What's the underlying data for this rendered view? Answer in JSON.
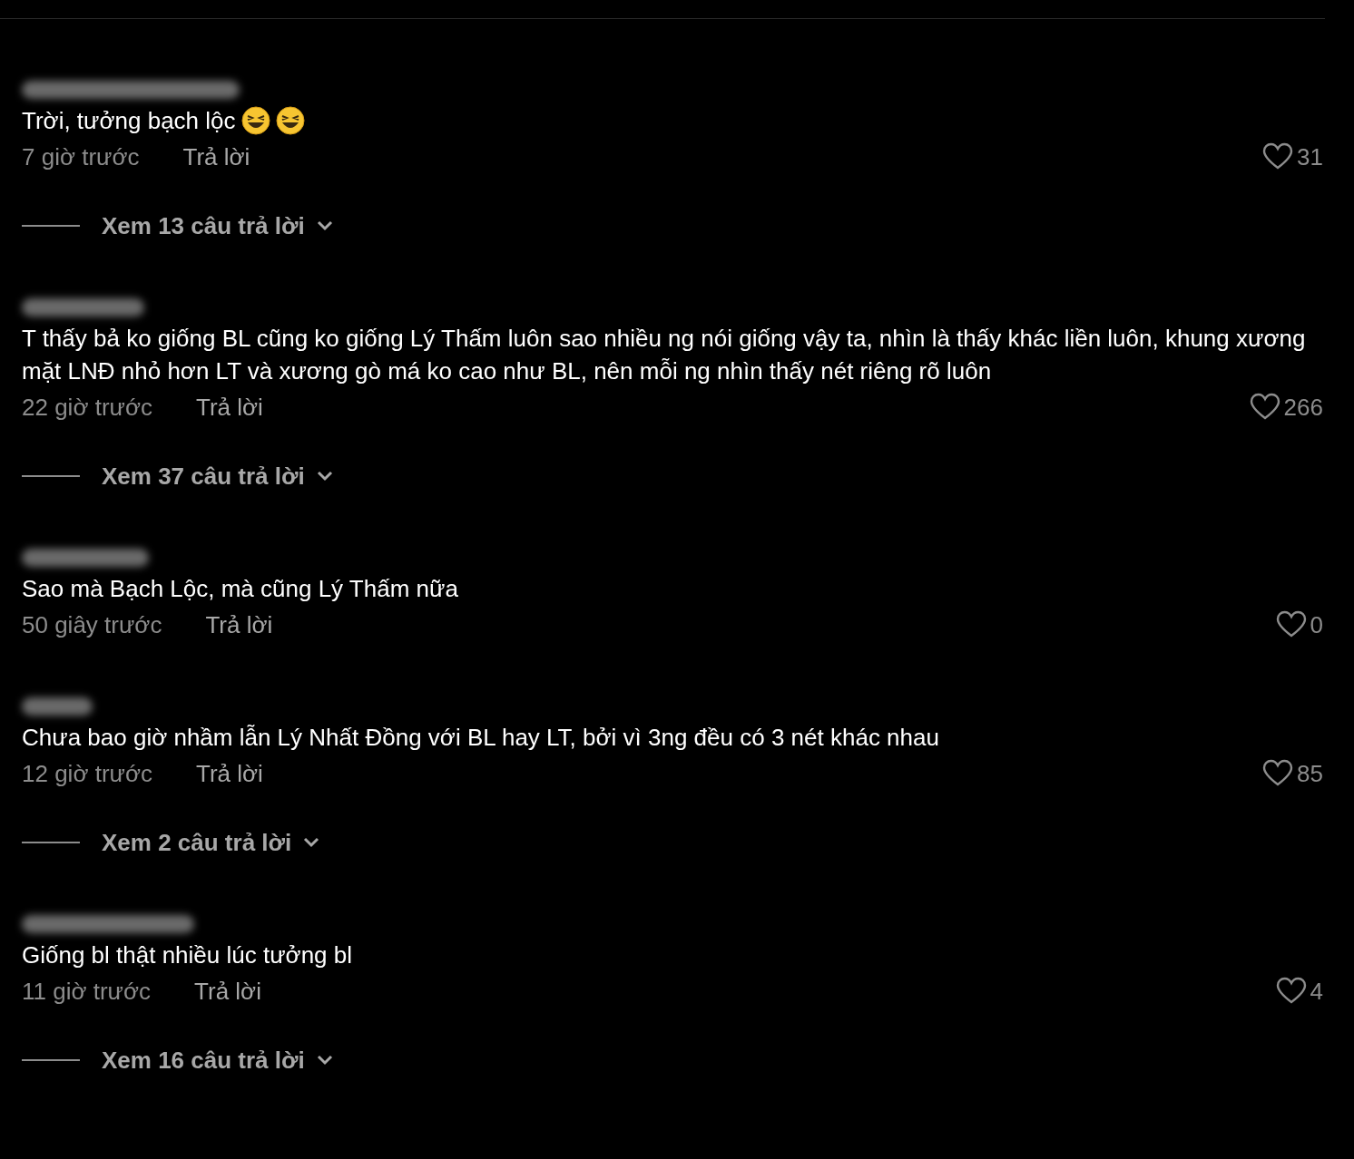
{
  "comments": [
    {
      "text": "Trời, tưởng bạch lộc",
      "emojis": [
        {
          "kind": "laughing"
        },
        {
          "kind": "laughing"
        }
      ],
      "time": "7 giờ trước",
      "reply": "Trả lời",
      "likes": "31",
      "replies": "Xem 13 câu trả lời"
    },
    {
      "text": "T thấy bả ko giống BL cũng ko giống Lý Thấm luôn sao nhiều ng nói giống vậy ta, nhìn là thấy khác liền luôn, khung xương mặt LNĐ nhỏ hơn LT và xương gò má ko cao như BL, nên mỗi ng nhìn thấy nét riêng rõ luôn",
      "time": "22 giờ trước",
      "reply": "Trả lời",
      "likes": "266",
      "replies": "Xem 37 câu trả lời"
    },
    {
      "text": "Sao mà Bạch Lộc, mà cũng Lý Thấm nữa",
      "time": "50 giây trước",
      "reply": "Trả lời",
      "likes": "0"
    },
    {
      "text": "Chưa bao giờ nhầm lẫn Lý Nhất Đồng với BL hay LT, bởi vì 3ng đều có 3 nét khác nhau",
      "time": "12 giờ trước",
      "reply": "Trả lời",
      "likes": "85",
      "replies": "Xem 2 câu trả lời"
    },
    {
      "text": "Giống bl thật nhiều lúc tưởng bl",
      "time": "11 giờ trước",
      "reply": "Trả lời",
      "likes": "4",
      "replies": "Xem 16 câu trả lời"
    }
  ]
}
